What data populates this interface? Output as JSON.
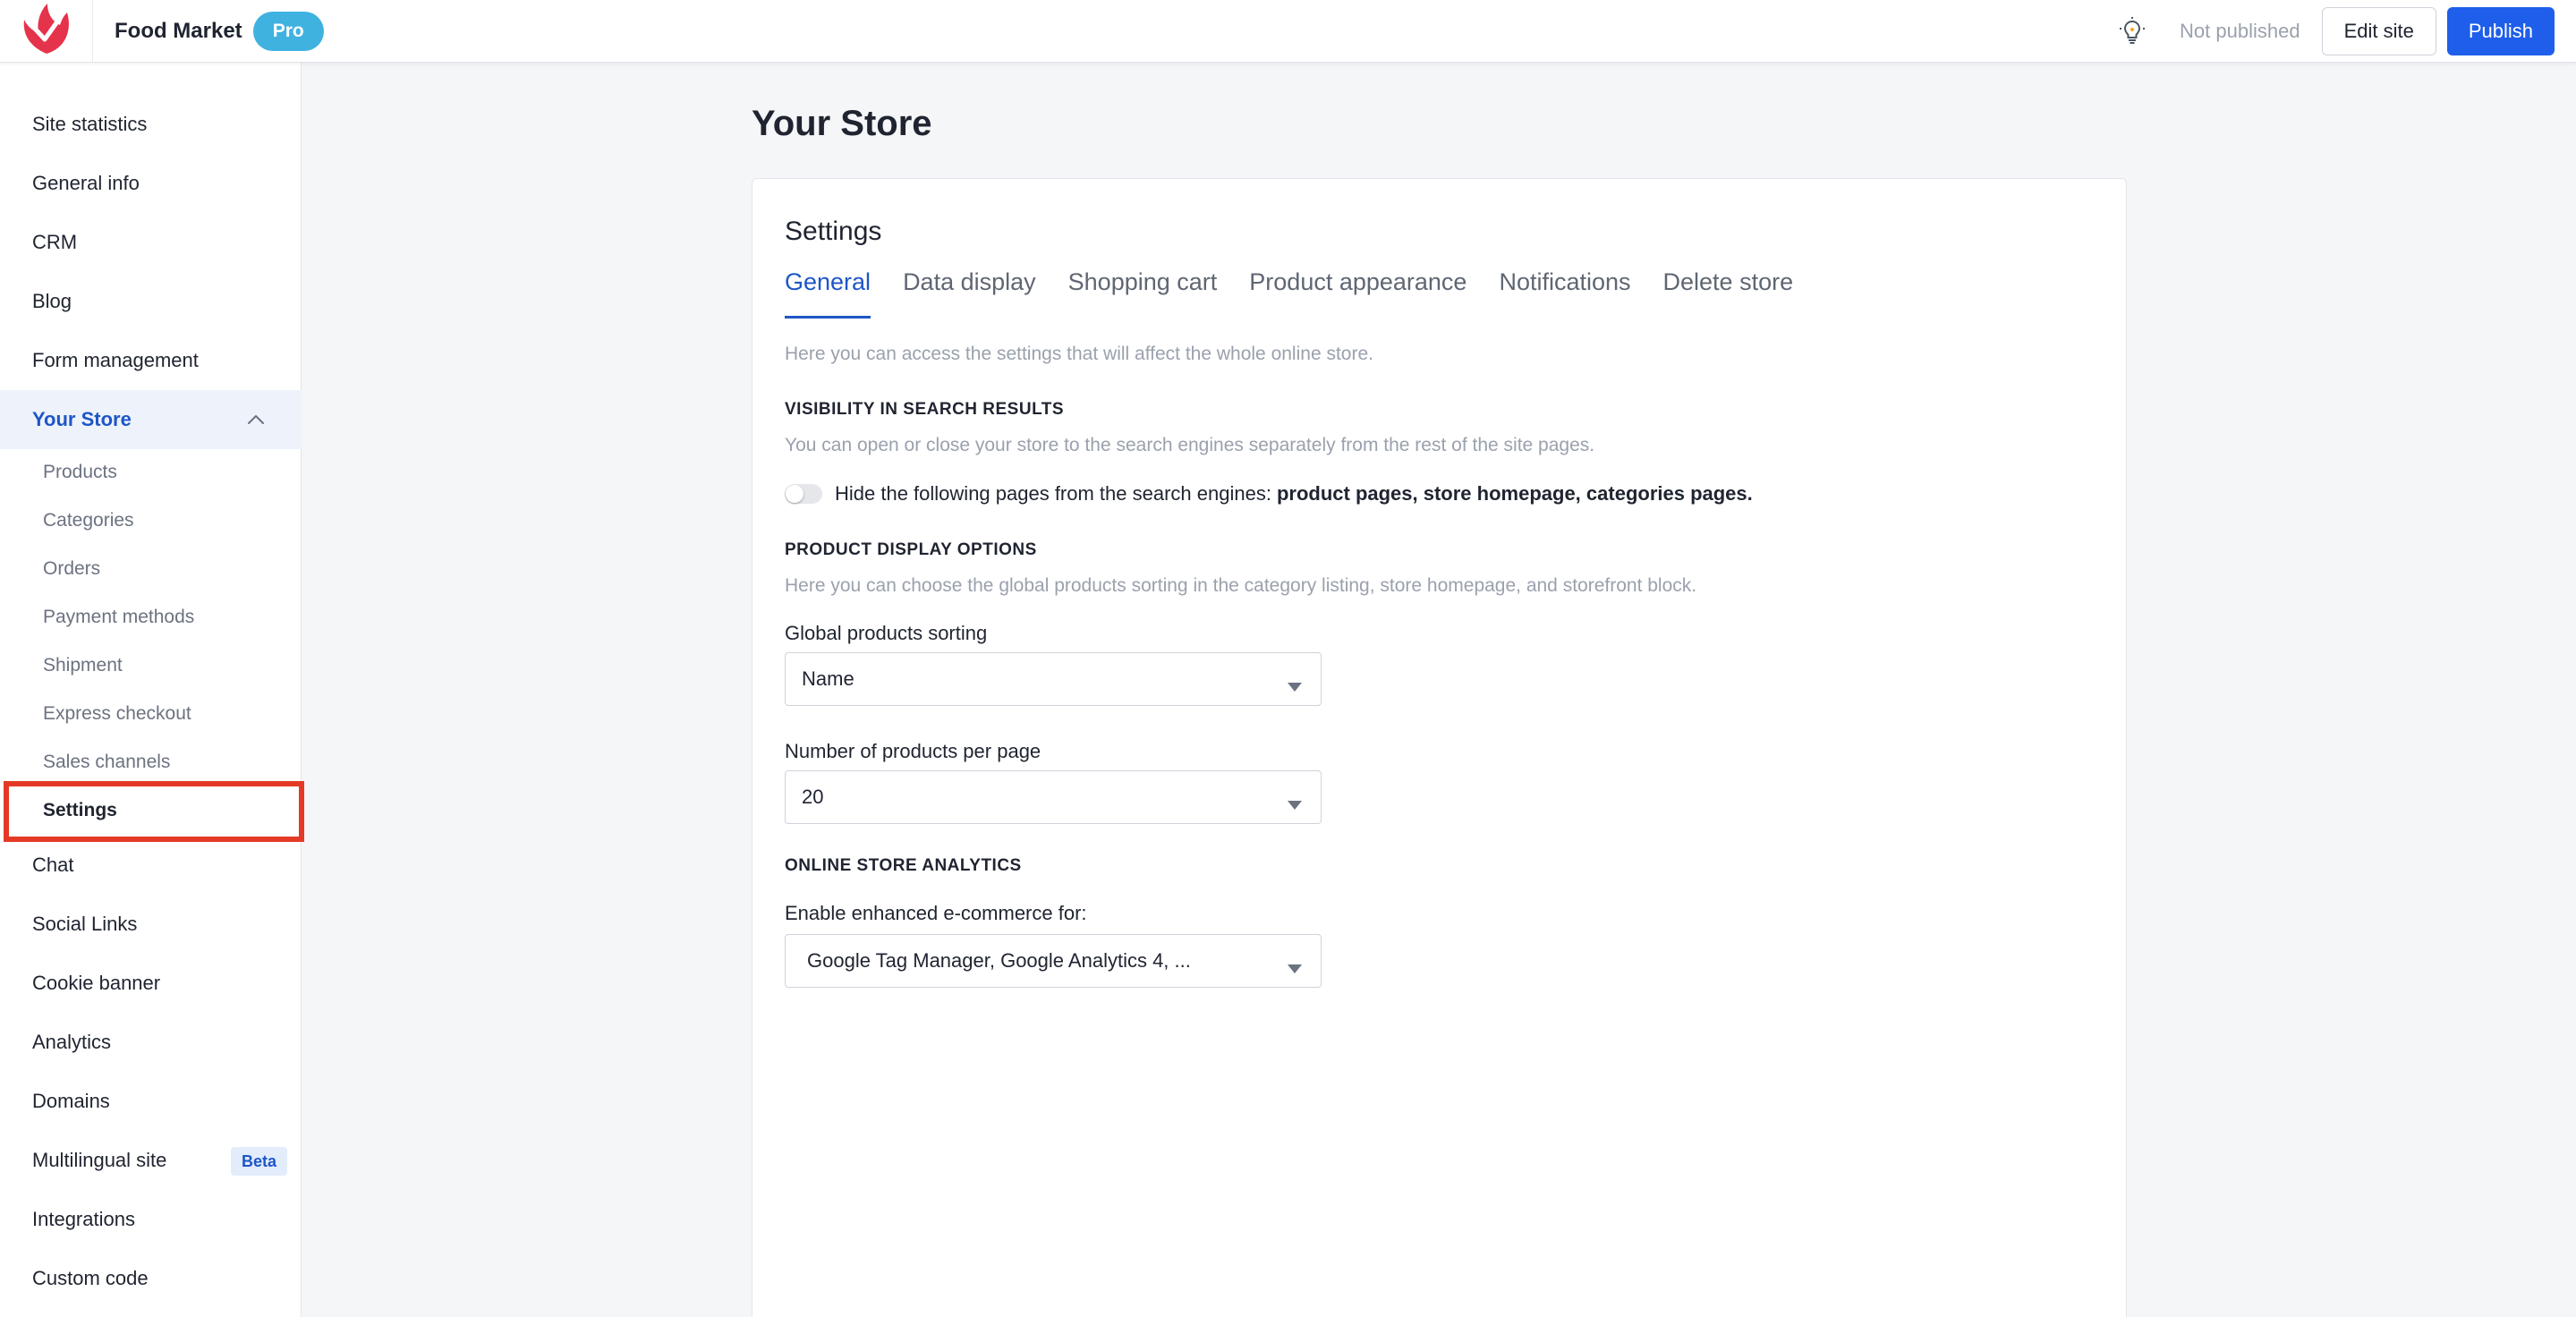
{
  "header": {
    "site_name": "Food Market",
    "badge": "Pro",
    "status": "Not published",
    "edit_label": "Edit site",
    "publish_label": "Publish",
    "accent_color": "#1e5eea",
    "logo_icon": "brand-logo-icon",
    "tip_icon": "lightbulb-icon"
  },
  "sidebar": {
    "items_top": [
      {
        "label": "Site statistics"
      },
      {
        "label": "General info"
      },
      {
        "label": "CRM"
      },
      {
        "label": "Blog"
      },
      {
        "label": "Form management"
      }
    ],
    "store": {
      "label": "Your Store",
      "expanded": true,
      "sub_items": [
        {
          "label": "Products"
        },
        {
          "label": "Categories"
        },
        {
          "label": "Orders"
        },
        {
          "label": "Payment methods"
        },
        {
          "label": "Shipment"
        },
        {
          "label": "Express checkout"
        },
        {
          "label": "Sales channels"
        },
        {
          "label": "Settings",
          "selected": true
        }
      ]
    },
    "items_bottom": [
      {
        "label": "Chat"
      },
      {
        "label": "Social Links"
      },
      {
        "label": "Cookie banner"
      },
      {
        "label": "Analytics"
      },
      {
        "label": "Domains"
      },
      {
        "label": "Multilingual site",
        "badge": "Beta"
      },
      {
        "label": "Integrations"
      },
      {
        "label": "Custom code"
      }
    ],
    "highlight_color": "#e43a25"
  },
  "main": {
    "page_title": "Your Store",
    "card_title": "Settings",
    "tabs": [
      {
        "label": "General",
        "active": true
      },
      {
        "label": "Data display"
      },
      {
        "label": "Shopping cart"
      },
      {
        "label": "Product appearance"
      },
      {
        "label": "Notifications"
      },
      {
        "label": "Delete store"
      }
    ],
    "intro": "Here you can access the settings that will affect the whole online store.",
    "visibility": {
      "heading": "VISIBILITY IN SEARCH RESULTS",
      "desc": "You can open or close your store to the search engines separately from the rest of the site pages.",
      "toggle_text": "Hide the following pages from the search engines:",
      "toggle_bold": "product pages, store homepage, categories pages.",
      "toggle_on": false
    },
    "display": {
      "heading": "PRODUCT DISPLAY OPTIONS",
      "desc": "Here you can choose the global products sorting in the category listing, store homepage, and storefront block.",
      "sorting_label": "Global products sorting",
      "sorting_value": "Name",
      "per_page_label": "Number of products per page",
      "per_page_value": "20"
    },
    "analytics": {
      "heading": "ONLINE STORE ANALYTICS",
      "label": "Enable enhanced e-commerce for:",
      "value": "Google Tag Manager, Google Analytics 4, ..."
    }
  }
}
